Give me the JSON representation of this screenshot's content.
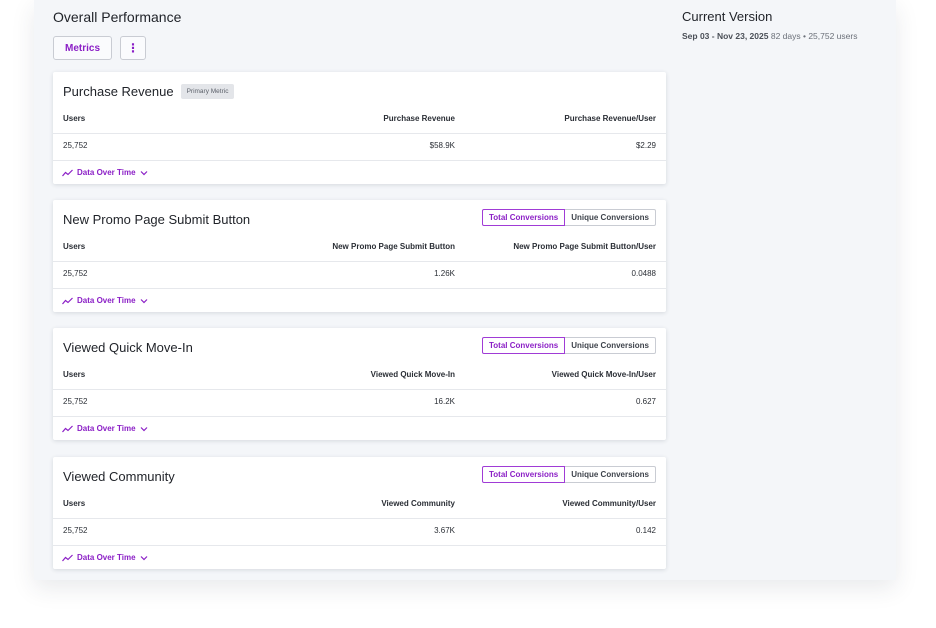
{
  "left": {
    "title": "Overall Performance",
    "metrics_label": "Metrics",
    "more_glyph": "⋮"
  },
  "right": {
    "title": "Current Version",
    "date_range": "Sep 03 - Nov 23, 2025",
    "meta": "82 days • 25,752 users"
  },
  "common": {
    "data_over_time": "Data Over Time",
    "total_conversions": "Total Conversions",
    "unique_conversions": "Unique Conversions"
  },
  "cards": [
    {
      "title": "Purchase Revenue",
      "tag": "Primary Metric",
      "col1": "Users",
      "col2": "Purchase Revenue",
      "col3": "Purchase Revenue/User",
      "v1": "25,752",
      "v2": "$58.9K",
      "v3": "$2.29"
    },
    {
      "title": "New Promo Page Submit Button",
      "col1": "Users",
      "col2": "New Promo Page Submit Button",
      "col3": "New Promo Page Submit Button/User",
      "v1": "25,752",
      "v2": "1.26K",
      "v3": "0.0488"
    },
    {
      "title": "Viewed Quick Move-In",
      "col1": "Users",
      "col2": "Viewed Quick Move-In",
      "col3": "Viewed Quick Move-In/User",
      "v1": "25,752",
      "v2": "16.2K",
      "v3": "0.627"
    },
    {
      "title": "Viewed Community",
      "col1": "Users",
      "col2": "Viewed Community",
      "col3": "Viewed Community/User",
      "v1": "25,752",
      "v2": "3.67K",
      "v3": "0.142"
    }
  ],
  "colors": {
    "accent": "#8b1fc6",
    "panel_bg": "#f4f6f9"
  }
}
